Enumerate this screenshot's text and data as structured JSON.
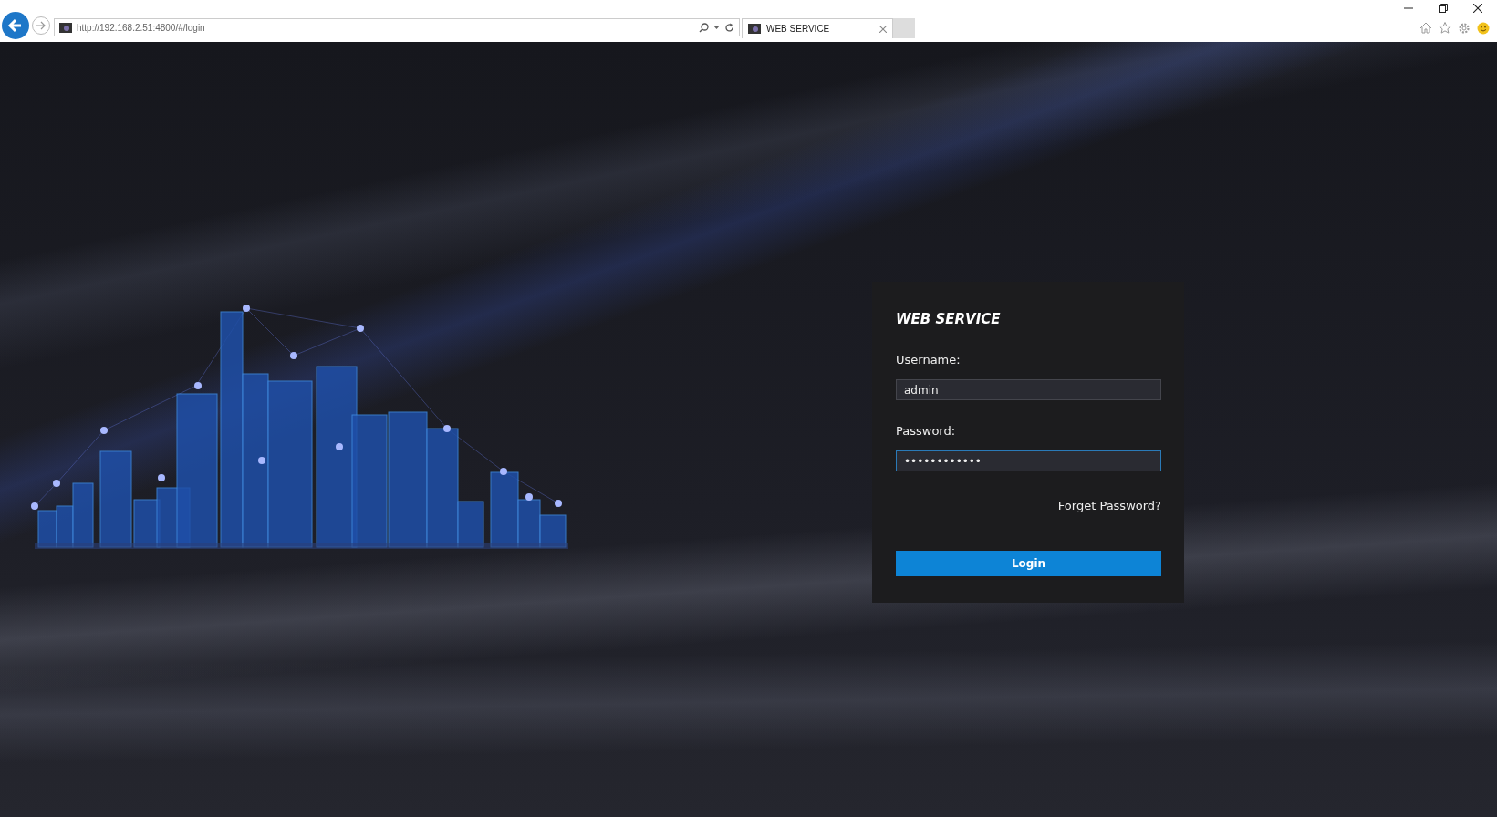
{
  "browser": {
    "address": "http://192.168.2.51:4800/#/login",
    "tab": {
      "title": "WEB SERVICE",
      "selected": true
    }
  },
  "login": {
    "title": "WEB SERVICE",
    "fields": [
      {
        "label": "Username:",
        "value": "admin",
        "focused": false
      },
      {
        "label": "Password:",
        "value": "••••••••••••",
        "focused": true
      }
    ],
    "forgot_link": "Forget Password?",
    "button": "Login"
  }
}
